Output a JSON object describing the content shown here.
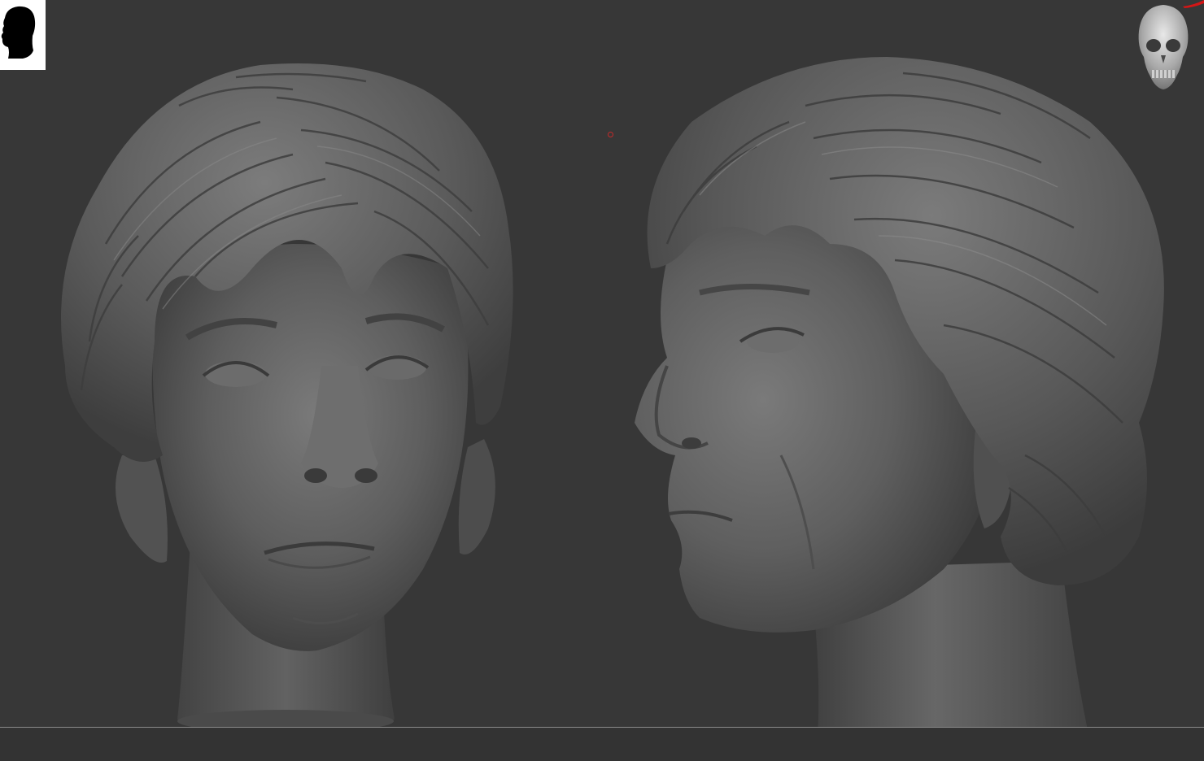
{
  "viewport": {
    "background": "#373737",
    "floor_line_color": "#8a8a8a",
    "pivot_color": "#c42a2a"
  },
  "thumbnails": {
    "head_silhouette_icon": "head-silhouette-icon",
    "skull_icon": "skull-icon",
    "head_thumb_background": "#ffffff"
  },
  "models": [
    {
      "view": "front",
      "icon": "sculpted-head-front-icon"
    },
    {
      "view": "three-quarter-side",
      "icon": "sculpted-head-side-icon"
    }
  ]
}
